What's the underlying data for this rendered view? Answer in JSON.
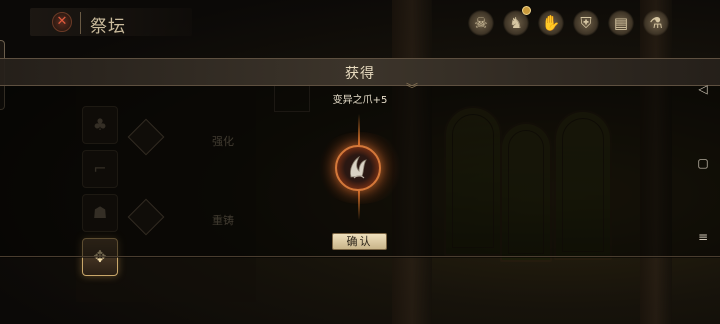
{
  "header": {
    "title": "祭坛",
    "close_glyph": "✕",
    "icons": [
      {
        "name": "skull-icon",
        "glyph": "☠",
        "badge": false
      },
      {
        "name": "beast-icon",
        "glyph": "♞",
        "badge": true
      },
      {
        "name": "hand-icon",
        "glyph": "✋",
        "badge": false
      },
      {
        "name": "shield-icon",
        "glyph": "⛨",
        "badge": false
      },
      {
        "name": "book-icon",
        "glyph": "▤",
        "badge": false
      },
      {
        "name": "potion-icon",
        "glyph": "⚗",
        "badge": false
      }
    ]
  },
  "altar": {
    "labels": [
      "强化",
      "重铸"
    ]
  },
  "reward_dialog": {
    "title": "获得",
    "item_name": "变异之爪+5",
    "confirm_label": "确认"
  },
  "nav": {
    "back_glyph": "◁",
    "home_glyph": "▢",
    "menu_glyph": "≡"
  },
  "colors": {
    "accent": "#e07a2c",
    "button_bg": "#e6d6b0",
    "title_text": "#e9dcc0"
  }
}
